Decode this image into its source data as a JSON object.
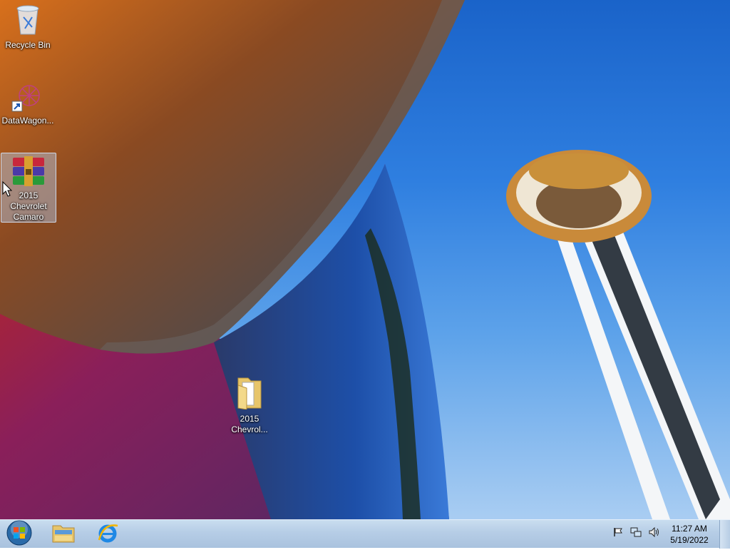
{
  "desktop": {
    "icons": [
      {
        "label": "Recycle Bin",
        "icon": "recycle-bin-icon"
      },
      {
        "label": "DataWagon...",
        "icon": "datawagon-shortcut-icon"
      },
      {
        "label": "2015 Chevrolet Camaro",
        "icon": "winrar-archive-icon",
        "selected": true
      },
      {
        "label": "2015 Chevrol...",
        "icon": "folder-icon"
      }
    ]
  },
  "taskbar": {
    "start": {
      "icon": "windows-start-orb-icon"
    },
    "pinned": [
      {
        "icon": "file-explorer-icon"
      },
      {
        "icon": "internet-explorer-icon"
      }
    ],
    "tray": {
      "icons": [
        "action-center-flag-icon",
        "network-icon",
        "volume-icon"
      ]
    },
    "clock": {
      "time": "11:27 AM",
      "date": "5/19/2022"
    }
  }
}
